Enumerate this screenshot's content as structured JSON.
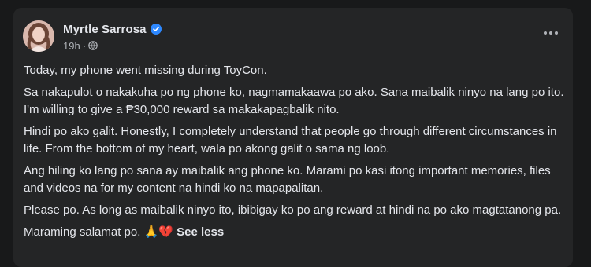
{
  "post": {
    "author": "Myrtle Sarrosa",
    "time": "19h",
    "meta_separator": "·",
    "paragraphs": [
      "Today, my phone went missing during ToyCon.",
      "Sa nakapulot o nakakuha po ng phone ko, nagmamakaawa po ako. Sana maibalik ninyo na lang po ito. I'm willing to give a ₱30,000 reward sa makakapagbalik nito.",
      "Hindi po ako galit. Honestly, I completely understand that people go through different circumstances in life. From the bottom of my heart, wala po akong galit o sama ng loob.",
      "Ang hiling ko lang po sana ay maibalik ang phone ko. Marami po kasi itong important memories, files and videos na for my content na hindi ko na mapapalitan.",
      "Please po. As long as maibalik ninyo ito, ibibigay ko po ang reward at hindi na po ako magtatanong pa."
    ],
    "closing_text": "Maraming salamat po.",
    "closing_emojis": "🙏💔",
    "see_less_label": "See less"
  },
  "icons": {
    "verified": "verified-badge-icon",
    "privacy": "globe-icon",
    "more": "more-options-icon"
  },
  "colors": {
    "background": "#18191a",
    "card": "#242526",
    "primary_text": "#e4e6eb",
    "secondary_text": "#b0b3b8",
    "verified_blue": "#2d88ff"
  }
}
